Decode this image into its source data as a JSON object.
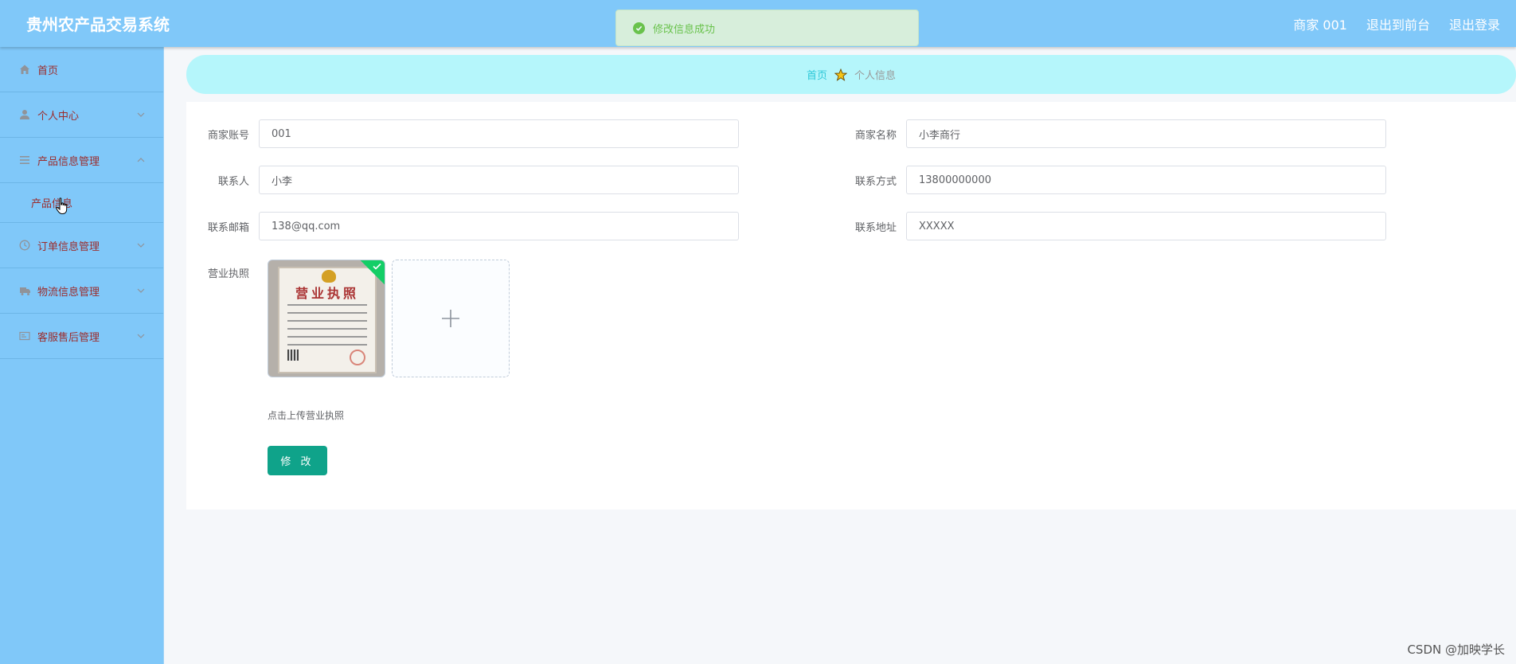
{
  "header": {
    "app_title": "贵州农产品交易系统",
    "user": "商家 001",
    "to_front": "退出到前台",
    "logout": "退出登录"
  },
  "toast": {
    "message": "修改信息成功"
  },
  "sidebar": {
    "items": [
      {
        "label": "首页",
        "icon": "home-icon"
      },
      {
        "label": "个人中心",
        "icon": "user-icon"
      },
      {
        "label": "产品信息管理",
        "icon": "list-icon",
        "expanded": true,
        "children": [
          "产品信息"
        ]
      },
      {
        "label": "订单信息管理",
        "icon": "clock-icon"
      },
      {
        "label": "物流信息管理",
        "icon": "truck-icon"
      },
      {
        "label": "客服售后管理",
        "icon": "card-icon"
      }
    ]
  },
  "breadcrumb": {
    "home": "首页",
    "current": "个人信息"
  },
  "form": {
    "account": {
      "label": "商家账号",
      "value": "001"
    },
    "name": {
      "label": "商家名称",
      "value": "小李商行"
    },
    "contact": {
      "label": "联系人",
      "value": "小李"
    },
    "phone": {
      "label": "联系方式",
      "value": "13800000000"
    },
    "email": {
      "label": "联系邮箱",
      "value": "138@qq.com"
    },
    "address": {
      "label": "联系地址",
      "value": "XXXXX"
    },
    "license": {
      "label": "营业执照",
      "tip": "点击上传营业执照",
      "image_title": "营业执照"
    },
    "submit": "修 改"
  },
  "watermark": "CSDN @加映学长",
  "colors": {
    "topbar": "#80c8f9",
    "sidebar": "#80c8f9",
    "breadcrumb_bg": "#b5f6fb",
    "submit_button": "#0fa38a",
    "menu_text": "#9b2c2c"
  }
}
